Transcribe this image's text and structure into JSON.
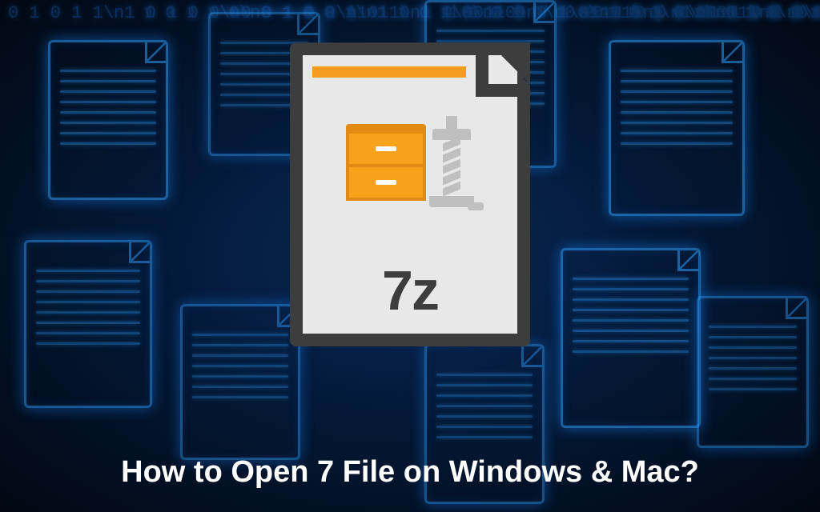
{
  "icon": {
    "label": "7z"
  },
  "caption": "How to Open 7 File on Windows & Mac?"
}
